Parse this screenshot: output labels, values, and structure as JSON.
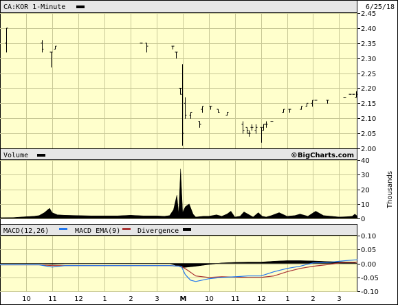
{
  "header": {
    "symbol_interval": "CA:KOR 1-Minute",
    "date": "6/25/18",
    "watermark": "©BigCharts.com"
  },
  "panels": {
    "volume_label": "Volume",
    "volume_unit": "Thousands",
    "macd_label": "MACD(12,26)",
    "macd_ema_label": "MACD EMA(9)",
    "divergence_label": "Divergence"
  },
  "colors": {
    "background": "#ffffff",
    "plot_bg": "#ffffcc",
    "header_bg": "#e6e6e6",
    "grid": "#c8c896",
    "price": "#000000",
    "macd": "#2277ee",
    "ema": "#aa3333",
    "divergence": "#000000"
  },
  "chart_data": [
    {
      "type": "ohlc",
      "title": "CA:KOR 1-Minute",
      "ylim": [
        2.0,
        2.45
      ],
      "yticks": [
        2.0,
        2.05,
        2.1,
        2.15,
        2.2,
        2.25,
        2.3,
        2.35,
        2.4,
        2.45
      ],
      "x_labels": [
        "10",
        "11",
        "12",
        "1",
        "2",
        "3",
        "M",
        "10",
        "11",
        "12",
        "1",
        "2",
        "3"
      ],
      "x_positions": [
        10.5,
        11.5,
        12.5,
        13.5,
        14.5,
        15.5,
        16.5,
        17.5,
        18.5,
        19.5,
        20.5,
        21.5,
        22.5
      ],
      "xlim": [
        9.5,
        23.2
      ],
      "grid": true,
      "bars": [
        {
          "x": 9.75,
          "o": 2.35,
          "h": 2.4,
          "l": 2.32,
          "c": 2.4
        },
        {
          "x": 11.1,
          "o": 2.35,
          "h": 2.36,
          "l": 2.32,
          "c": 2.33
        },
        {
          "x": 11.45,
          "o": 2.32,
          "h": 2.32,
          "l": 2.27,
          "c": 2.32
        },
        {
          "x": 11.6,
          "o": 2.33,
          "h": 2.34,
          "l": 2.33,
          "c": 2.34
        },
        {
          "x": 14.9,
          "o": 2.35,
          "h": 2.35,
          "l": 2.35,
          "c": 2.35
        },
        {
          "x": 15.1,
          "o": 2.35,
          "h": 2.35,
          "l": 2.32,
          "c": 2.34
        },
        {
          "x": 16.1,
          "o": 2.34,
          "h": 2.34,
          "l": 2.33,
          "c": 2.34
        },
        {
          "x": 16.25,
          "o": 2.32,
          "h": 2.32,
          "l": 2.3,
          "c": 2.32
        },
        {
          "x": 16.4,
          "o": 2.2,
          "h": 2.2,
          "l": 2.18,
          "c": 2.2
        },
        {
          "x": 16.48,
          "o": 2.18,
          "h": 2.28,
          "l": 2.01,
          "c": 2.05
        },
        {
          "x": 16.6,
          "o": 2.15,
          "h": 2.17,
          "l": 2.1,
          "c": 2.11
        },
        {
          "x": 16.8,
          "o": 2.11,
          "h": 2.12,
          "l": 2.1,
          "c": 2.12
        },
        {
          "x": 17.15,
          "o": 2.09,
          "h": 2.09,
          "l": 2.07,
          "c": 2.08
        },
        {
          "x": 17.25,
          "o": 2.13,
          "h": 2.14,
          "l": 2.12,
          "c": 2.14
        },
        {
          "x": 17.55,
          "o": 2.14,
          "h": 2.14,
          "l": 2.13,
          "c": 2.14
        },
        {
          "x": 17.85,
          "o": 2.13,
          "h": 2.13,
          "l": 2.12,
          "c": 2.12
        },
        {
          "x": 18.2,
          "o": 2.11,
          "h": 2.12,
          "l": 2.11,
          "c": 2.12
        },
        {
          "x": 18.8,
          "o": 2.08,
          "h": 2.09,
          "l": 2.05,
          "c": 2.06
        },
        {
          "x": 18.95,
          "o": 2.07,
          "h": 2.07,
          "l": 2.05,
          "c": 2.06
        },
        {
          "x": 19.05,
          "o": 2.05,
          "h": 2.06,
          "l": 2.04,
          "c": 2.05
        },
        {
          "x": 19.15,
          "o": 2.07,
          "h": 2.08,
          "l": 2.06,
          "c": 2.07
        },
        {
          "x": 19.3,
          "o": 2.06,
          "h": 2.08,
          "l": 2.05,
          "c": 2.07
        },
        {
          "x": 19.5,
          "o": 2.07,
          "h": 2.07,
          "l": 2.02,
          "c": 2.06
        },
        {
          "x": 19.6,
          "o": 2.07,
          "h": 2.08,
          "l": 2.06,
          "c": 2.08
        },
        {
          "x": 19.7,
          "o": 2.08,
          "h": 2.09,
          "l": 2.07,
          "c": 2.08
        },
        {
          "x": 19.9,
          "o": 2.09,
          "h": 2.09,
          "l": 2.09,
          "c": 2.09
        },
        {
          "x": 20.35,
          "o": 2.12,
          "h": 2.13,
          "l": 2.12,
          "c": 2.13
        },
        {
          "x": 20.6,
          "o": 2.13,
          "h": 2.13,
          "l": 2.12,
          "c": 2.13
        },
        {
          "x": 21.05,
          "o": 2.13,
          "h": 2.14,
          "l": 2.13,
          "c": 2.14
        },
        {
          "x": 21.25,
          "o": 2.14,
          "h": 2.15,
          "l": 2.14,
          "c": 2.15
        },
        {
          "x": 21.45,
          "o": 2.15,
          "h": 2.16,
          "l": 2.14,
          "c": 2.16
        },
        {
          "x": 21.6,
          "o": 2.16,
          "h": 2.16,
          "l": 2.16,
          "c": 2.16
        },
        {
          "x": 22.05,
          "o": 2.16,
          "h": 2.16,
          "l": 2.15,
          "c": 2.16
        },
        {
          "x": 22.7,
          "o": 2.17,
          "h": 2.17,
          "l": 2.17,
          "c": 2.17
        },
        {
          "x": 22.9,
          "o": 2.18,
          "h": 2.18,
          "l": 2.18,
          "c": 2.18
        },
        {
          "x": 23.05,
          "o": 2.18,
          "h": 2.18,
          "l": 2.18,
          "c": 2.18
        },
        {
          "x": 23.15,
          "o": 2.17,
          "h": 2.19,
          "l": 2.17,
          "c": 2.18
        }
      ]
    },
    {
      "type": "area",
      "title": "Volume",
      "ylabel": "Thousands",
      "ylim": [
        0,
        40
      ],
      "yticks": [
        0,
        10,
        20,
        30,
        40
      ],
      "x": [
        9.5,
        10.0,
        10.5,
        10.8,
        11.0,
        11.2,
        11.4,
        11.5,
        11.7,
        12.0,
        12.5,
        13.0,
        13.5,
        14.0,
        14.5,
        15.0,
        15.5,
        15.8,
        16.0,
        16.15,
        16.28,
        16.35,
        16.42,
        16.5,
        16.6,
        16.75,
        16.9,
        17.0,
        17.3,
        17.5,
        17.8,
        18.0,
        18.2,
        18.35,
        18.5,
        18.7,
        18.85,
        19.0,
        19.2,
        19.4,
        19.55,
        19.7,
        19.9,
        20.2,
        20.5,
        20.8,
        21.0,
        21.3,
        21.6,
        21.9,
        22.2,
        22.5,
        22.8,
        23.0,
        23.1,
        23.2
      ],
      "values": [
        0.5,
        0.6,
        1.2,
        1.5,
        2.0,
        4.0,
        7.0,
        4.0,
        2.5,
        2.2,
        2.0,
        1.8,
        1.8,
        1.8,
        2.2,
        1.8,
        1.8,
        1.5,
        2.0,
        6.0,
        16.0,
        3.0,
        34.0,
        4.0,
        8.0,
        10.0,
        3.0,
        1.0,
        1.5,
        1.5,
        2.5,
        1.5,
        3.0,
        5.0,
        1.0,
        1.5,
        4.5,
        3.0,
        1.0,
        4.0,
        1.5,
        1.0,
        2.0,
        4.0,
        1.5,
        2.0,
        3.0,
        1.5,
        5.0,
        2.0,
        1.5,
        1.0,
        1.2,
        1.5,
        3.0,
        1.5
      ]
    },
    {
      "type": "line",
      "title": "MACD(12,26)",
      "ylim": [
        -0.1,
        0.1
      ],
      "yticks": [
        -0.1,
        -0.05,
        0.0,
        0.05,
        0.1
      ],
      "series": [
        {
          "name": "MACD EMA(9)",
          "x": [
            9.5,
            11.0,
            11.5,
            12.0,
            13.0,
            14.0,
            15.0,
            16.0,
            16.45,
            16.7,
            17.0,
            17.5,
            18.0,
            19.0,
            19.5,
            20.0,
            20.5,
            21.0,
            21.5,
            22.0,
            22.5,
            23.0,
            23.2
          ],
          "values": [
            -0.005,
            -0.005,
            -0.008,
            -0.008,
            -0.008,
            -0.008,
            -0.008,
            -0.008,
            -0.01,
            -0.025,
            -0.045,
            -0.05,
            -0.048,
            -0.05,
            -0.05,
            -0.045,
            -0.03,
            -0.018,
            -0.01,
            -0.005,
            0.002,
            0.004,
            0.005
          ]
        },
        {
          "name": "MACD(12,26)",
          "x": [
            9.5,
            11.0,
            11.5,
            12.0,
            13.0,
            14.0,
            15.0,
            16.0,
            16.45,
            16.6,
            16.8,
            17.0,
            17.5,
            18.0,
            18.5,
            19.0,
            19.5,
            20.0,
            20.5,
            21.0,
            21.5,
            22.0,
            22.5,
            23.0,
            23.2
          ],
          "values": [
            -0.005,
            -0.005,
            -0.013,
            -0.008,
            -0.008,
            -0.008,
            -0.008,
            -0.008,
            -0.01,
            -0.04,
            -0.06,
            -0.065,
            -0.055,
            -0.05,
            -0.048,
            -0.045,
            -0.045,
            -0.03,
            -0.018,
            -0.01,
            0.002,
            0.003,
            0.008,
            0.012,
            0.013
          ]
        }
      ],
      "divergence": {
        "name": "Divergence",
        "x": [
          9.5,
          11.0,
          11.5,
          12.0,
          16.0,
          16.5,
          17.0,
          17.5,
          18.0,
          18.5,
          19.0,
          19.5,
          20.0,
          20.5,
          21.0,
          21.5,
          22.0,
          22.5,
          23.0,
          23.2
        ],
        "values": [
          0.0,
          0.0,
          -0.003,
          -0.001,
          0.0,
          -0.015,
          -0.01,
          -0.004,
          0.002,
          0.004,
          0.005,
          0.005,
          0.008,
          0.01,
          0.01,
          0.009,
          0.007,
          0.006,
          0.005,
          0.0
        ]
      }
    }
  ]
}
